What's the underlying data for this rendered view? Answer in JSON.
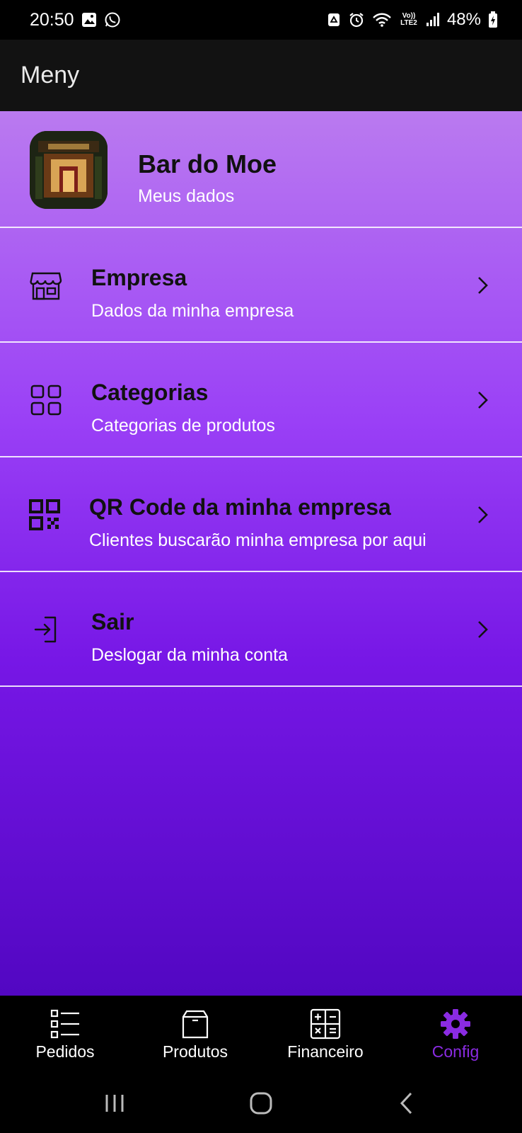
{
  "status_bar": {
    "time": "20:50",
    "network_label": "Vo)) LTE2",
    "battery": "48%",
    "icons": [
      "image-icon",
      "whatsapp-icon",
      "recycle-icon",
      "alarm-icon",
      "wifi-icon",
      "signal-icon",
      "battery-charging-icon"
    ]
  },
  "app_bar": {
    "title": "Meny"
  },
  "profile": {
    "name": "Bar do Moe",
    "subtitle": "Meus dados"
  },
  "menu": {
    "items": [
      {
        "title": "Empresa",
        "subtitle": "Dados da minha empresa",
        "icon": "store-icon"
      },
      {
        "title": "Categorias",
        "subtitle": "Categorias de produtos",
        "icon": "grid-icon"
      },
      {
        "title": "QR Code da minha empresa",
        "subtitle": "Clientes buscarão minha empresa por aqui",
        "icon": "qr-code-icon"
      },
      {
        "title": "Sair",
        "subtitle": "Deslogar da minha conta",
        "icon": "logout-icon"
      }
    ]
  },
  "bottom_nav": {
    "items": [
      {
        "label": "Pedidos",
        "icon": "list-icon",
        "active": false
      },
      {
        "label": "Produtos",
        "icon": "box-icon",
        "active": false
      },
      {
        "label": "Financeiro",
        "icon": "calculator-icon",
        "active": false
      },
      {
        "label": "Config",
        "icon": "gear-icon",
        "active": true
      }
    ]
  },
  "colors": {
    "accent": "#8a2be2",
    "gradient_top": "#ba7af0",
    "gradient_bottom": "#5207c2",
    "app_bar": "#121212"
  }
}
